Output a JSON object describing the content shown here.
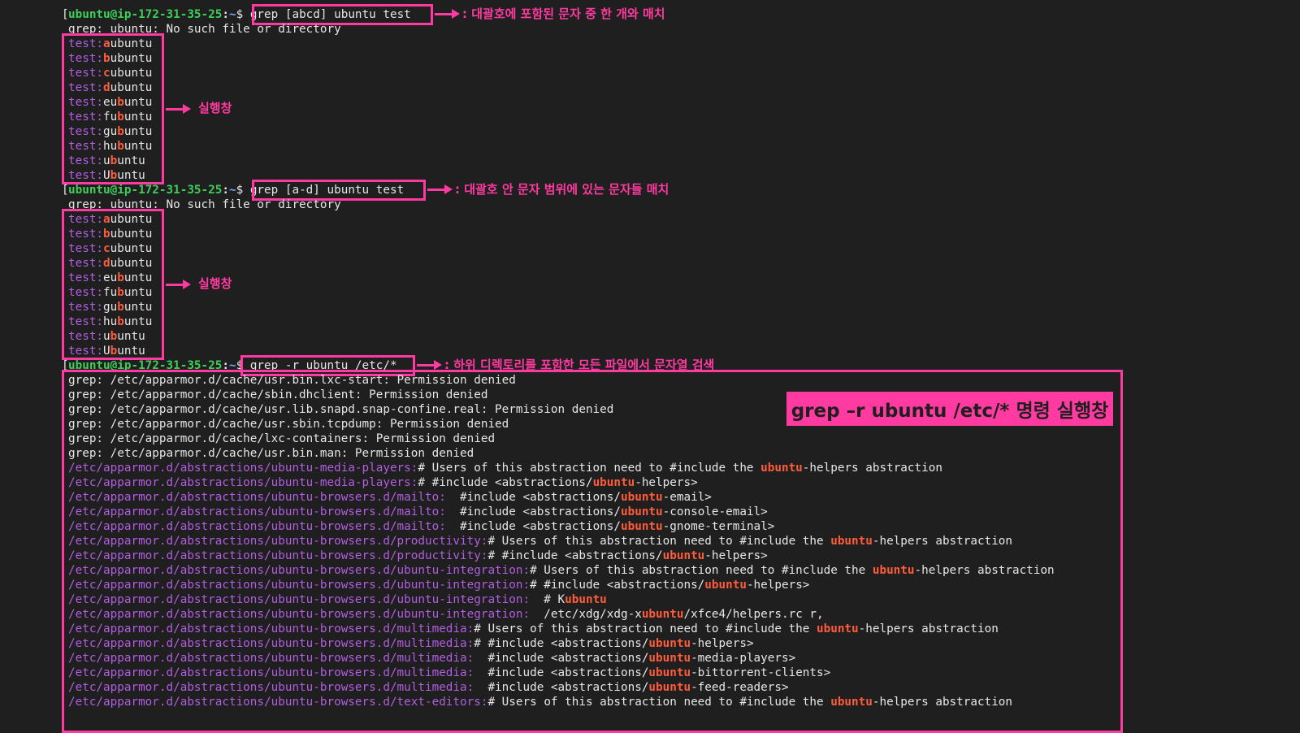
{
  "terminal": {
    "prompt": {
      "user_host": "ubuntu@ip-172-31-35-25",
      "colon": ":",
      "tilde": "~",
      "dollar": "$"
    },
    "blocks": [
      {
        "command": "grep [abcd] ubuntu test",
        "note": ": 대괄호에 포함된 문자 중 한 개와 매치",
        "error": "grep: ubuntu: No such file or directory",
        "result_label": "실행창",
        "results": [
          {
            "file": "test:",
            "match": "a",
            "rest": "",
            "tail": "ubuntu",
            "note_first": "a"
          },
          {
            "file": "test:",
            "pre": "",
            "match": "b",
            "rest": "ubuntu"
          },
          {
            "file": "test:",
            "pre": "",
            "match": "c",
            "rest": "ubuntu"
          },
          {
            "file": "test:",
            "pre": "",
            "match": "d",
            "rest": "ubuntu"
          },
          {
            "file": "test:",
            "pre": "eu",
            "match": "b",
            "rest": "untu"
          },
          {
            "file": "test:",
            "pre": "fu",
            "match": "b",
            "rest": "untu"
          },
          {
            "file": "test:",
            "pre": "gu",
            "match": "b",
            "rest": "untu"
          },
          {
            "file": "test:",
            "pre": "hu",
            "match": "b",
            "rest": "untu"
          },
          {
            "file": "test:",
            "pre": "u",
            "match": "b",
            "rest": "untu"
          },
          {
            "file": "test:",
            "pre": "U",
            "match": "b",
            "rest": "untu"
          }
        ]
      },
      {
        "command": "grep [a-d] ubuntu test",
        "note": ": 대괄호 안 문자 범위에 있는 문자들 매치",
        "error": "grep: ubuntu: No such file or directory",
        "result_label": "실행창",
        "results": [
          {
            "file": "test:",
            "pre": "",
            "match": "a",
            "rest": "ubuntu"
          },
          {
            "file": "test:",
            "pre": "",
            "match": "b",
            "rest": "ubuntu"
          },
          {
            "file": "test:",
            "pre": "",
            "match": "c",
            "rest": "ubuntu"
          },
          {
            "file": "test:",
            "pre": "",
            "match": "d",
            "rest": "ubuntu"
          },
          {
            "file": "test:",
            "pre": "eu",
            "match": "b",
            "rest": "untu"
          },
          {
            "file": "test:",
            "pre": "fu",
            "match": "b",
            "rest": "untu"
          },
          {
            "file": "test:",
            "pre": "gu",
            "match": "b",
            "rest": "untu"
          },
          {
            "file": "test:",
            "pre": "hu",
            "match": "b",
            "rest": "untu"
          },
          {
            "file": "test:",
            "pre": "u",
            "match": "b",
            "rest": "untu"
          },
          {
            "file": "test:",
            "pre": "U",
            "match": "b",
            "rest": "untu"
          }
        ]
      }
    ],
    "recursive": {
      "command": "grep -r ubuntu /etc/*",
      "note": ": 하위 디렉토리를 포함한 모든 파일에서 문자열 검색",
      "title": "grep –r ubuntu /etc/* 명령 실행창",
      "errors": [
        "grep: /etc/apparmor.d/cache/usr.bin.lxc-start: Permission denied",
        "grep: /etc/apparmor.d/cache/sbin.dhclient: Permission denied",
        "grep: /etc/apparmor.d/cache/usr.lib.snapd.snap-confine.real: Permission denied",
        "grep: /etc/apparmor.d/cache/usr.sbin.tcpdump: Permission denied",
        "grep: /etc/apparmor.d/cache/lxc-containers: Permission denied",
        "grep: /etc/apparmor.d/cache/usr.bin.man: Permission denied"
      ],
      "results": [
        {
          "file": "/etc/apparmor.d/abstractions/ubuntu-media-players:",
          "pre": "# Users of this abstraction need to #include the ",
          "match": "ubuntu",
          "post": "-helpers abstraction"
        },
        {
          "file": "/etc/apparmor.d/abstractions/ubuntu-media-players:",
          "pre": "# #include <abstractions/",
          "match": "ubuntu",
          "post": "-helpers>"
        },
        {
          "file": "/etc/apparmor.d/abstractions/ubuntu-browsers.d/mailto:",
          "pre": "  #include <abstractions/",
          "match": "ubuntu",
          "post": "-email>"
        },
        {
          "file": "/etc/apparmor.d/abstractions/ubuntu-browsers.d/mailto:",
          "pre": "  #include <abstractions/",
          "match": "ubuntu",
          "post": "-console-email>"
        },
        {
          "file": "/etc/apparmor.d/abstractions/ubuntu-browsers.d/mailto:",
          "pre": "  #include <abstractions/",
          "match": "ubuntu",
          "post": "-gnome-terminal>"
        },
        {
          "file": "/etc/apparmor.d/abstractions/ubuntu-browsers.d/productivity:",
          "pre": "# Users of this abstraction need to #include the ",
          "match": "ubuntu",
          "post": "-helpers abstraction"
        },
        {
          "file": "/etc/apparmor.d/abstractions/ubuntu-browsers.d/productivity:",
          "pre": "# #include <abstractions/",
          "match": "ubuntu",
          "post": "-helpers>"
        },
        {
          "file": "/etc/apparmor.d/abstractions/ubuntu-browsers.d/ubuntu-integration:",
          "pre": "# Users of this abstraction need to #include the ",
          "match": "ubuntu",
          "post": "-helpers abstraction"
        },
        {
          "file": "/etc/apparmor.d/abstractions/ubuntu-browsers.d/ubuntu-integration:",
          "pre": "# #include <abstractions/",
          "match": "ubuntu",
          "post": "-helpers>"
        },
        {
          "file": "/etc/apparmor.d/abstractions/ubuntu-browsers.d/ubuntu-integration:",
          "pre": "  # K",
          "match": "ubuntu",
          "post": ""
        },
        {
          "file": "/etc/apparmor.d/abstractions/ubuntu-browsers.d/ubuntu-integration:",
          "pre": "  /etc/xdg/xdg-x",
          "match": "ubuntu",
          "post": "/xfce4/helpers.rc r,"
        },
        {
          "file": "/etc/apparmor.d/abstractions/ubuntu-browsers.d/multimedia:",
          "pre": "# Users of this abstraction need to #include the ",
          "match": "ubuntu",
          "post": "-helpers abstraction"
        },
        {
          "file": "/etc/apparmor.d/abstractions/ubuntu-browsers.d/multimedia:",
          "pre": "# #include <abstractions/",
          "match": "ubuntu",
          "post": "-helpers>"
        },
        {
          "file": "/etc/apparmor.d/abstractions/ubuntu-browsers.d/multimedia:",
          "pre": "  #include <abstractions/",
          "match": "ubuntu",
          "post": "-media-players>"
        },
        {
          "file": "/etc/apparmor.d/abstractions/ubuntu-browsers.d/multimedia:",
          "pre": "  #include <abstractions/",
          "match": "ubuntu",
          "post": "-bittorrent-clients>"
        },
        {
          "file": "/etc/apparmor.d/abstractions/ubuntu-browsers.d/multimedia:",
          "pre": "  #include <abstractions/",
          "match": "ubuntu",
          "post": "-feed-readers>"
        },
        {
          "file": "/etc/apparmor.d/abstractions/ubuntu-browsers.d/text-editors:",
          "pre": "# Users of this abstraction need to #include the ",
          "match": "ubuntu",
          "post": "-helpers abstraction"
        }
      ]
    }
  }
}
